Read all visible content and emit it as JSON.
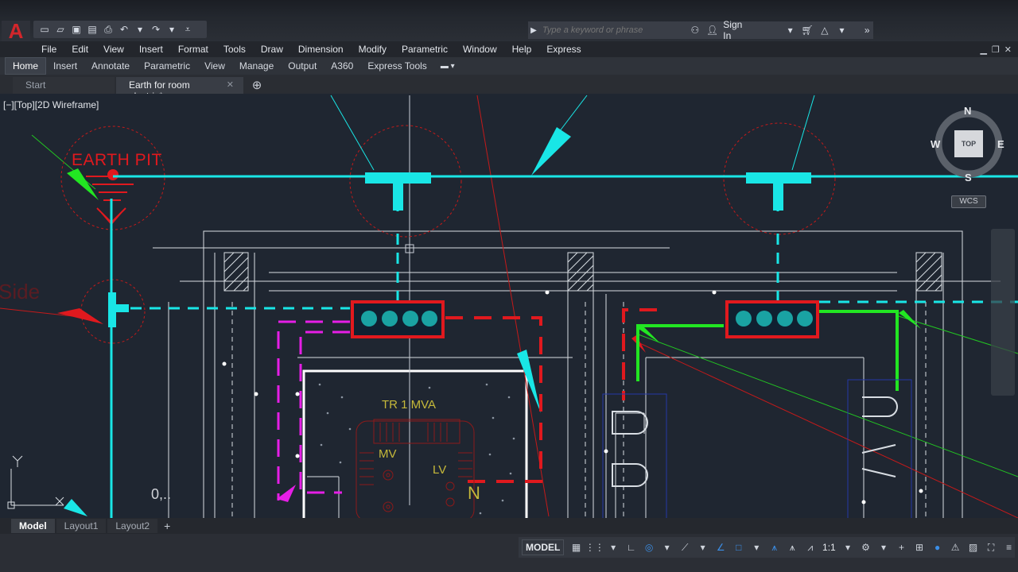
{
  "app": {
    "logo": "A",
    "search_placeholder": "Type a keyword or phrase",
    "sign_in": "Sign In"
  },
  "menu": [
    "File",
    "Edit",
    "View",
    "Insert",
    "Format",
    "Tools",
    "Draw",
    "Dimension",
    "Modify",
    "Parametric",
    "Window",
    "Help",
    "Express"
  ],
  "ribbon_tabs": [
    "Home",
    "Insert",
    "Annotate",
    "Parametric",
    "View",
    "Manage",
    "Output",
    "A360",
    "Express Tools"
  ],
  "doc_tabs": {
    "start": "Start",
    "active": "Earth for room electric*",
    "close": "✕"
  },
  "viewport": {
    "label": "[−][Top][2D Wireframe]"
  },
  "drawing": {
    "earth_pit": "EARTH PIT",
    "tr": "TR  1  MVA",
    "mv": "MV",
    "lv": "LV",
    "n": "N",
    "side_text": "Side",
    "cursor_text": "0,.."
  },
  "viewcube": {
    "n": "N",
    "s": "S",
    "e": "E",
    "w": "W",
    "top": "TOP",
    "wcs": "WCS"
  },
  "layout_tabs": [
    "Model",
    "Layout1",
    "Layout2"
  ],
  "status": {
    "model": "MODEL",
    "scale": "1:1"
  },
  "colors": {
    "cyan": "#19e6e6",
    "red": "#e0191e",
    "green": "#22e622",
    "magenta": "#e61ee6",
    "background": "#1f2631"
  }
}
